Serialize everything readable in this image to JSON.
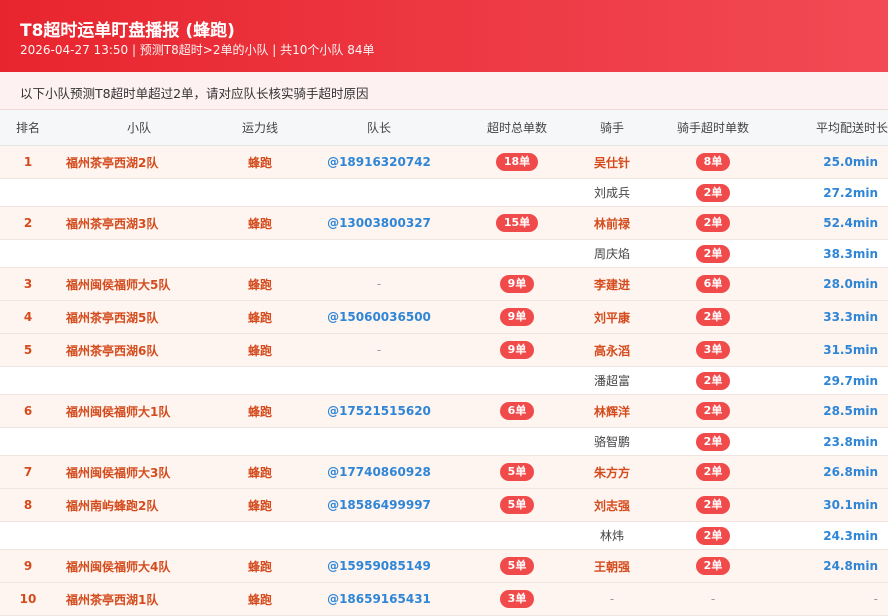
{
  "header": {
    "title": "T8超时运单盯盘播报 (蜂跑)",
    "subtitle": "2026-04-27 13:50 | 预测T8超时>2单的小队 | 共10个小队 84单",
    "bg_color": "#e8252e"
  },
  "notice": "以下小队预测T8超时单超过2单，请对应队长核实骑手超时原因",
  "columns": [
    "排名",
    "小队",
    "运力线",
    "队长",
    "超时总单数",
    "骑手",
    "骑手超时单数",
    "平均配送时长"
  ],
  "rows": [
    {
      "kind": "team",
      "rank": "1",
      "team": "福州茶亭西湖2队",
      "line": "蜂跑",
      "captain": "@18916320742",
      "total": "18单",
      "rider": "吴仕针",
      "rider_count": "8单",
      "avg": "25.0min"
    },
    {
      "kind": "sub",
      "rank": "",
      "team": "",
      "line": "",
      "captain": "",
      "total": "",
      "rider": "刘成兵",
      "rider_count": "2单",
      "avg": "27.2min"
    },
    {
      "kind": "team",
      "rank": "2",
      "team": "福州茶亭西湖3队",
      "line": "蜂跑",
      "captain": "@13003800327",
      "total": "15单",
      "rider": "林前禄",
      "rider_count": "2单",
      "avg": "52.4min"
    },
    {
      "kind": "sub",
      "rank": "",
      "team": "",
      "line": "",
      "captain": "",
      "total": "",
      "rider": "周庆焰",
      "rider_count": "2单",
      "avg": "38.3min"
    },
    {
      "kind": "team",
      "rank": "3",
      "team": "福州闽侯福师大5队",
      "line": "蜂跑",
      "captain": "-",
      "total": "9单",
      "rider": "李建进",
      "rider_count": "6单",
      "avg": "28.0min"
    },
    {
      "kind": "team",
      "rank": "4",
      "team": "福州茶亭西湖5队",
      "line": "蜂跑",
      "captain": "@15060036500",
      "total": "9单",
      "rider": "刘平康",
      "rider_count": "2单",
      "avg": "33.3min"
    },
    {
      "kind": "team",
      "rank": "5",
      "team": "福州茶亭西湖6队",
      "line": "蜂跑",
      "captain": "-",
      "total": "9单",
      "rider": "高永滔",
      "rider_count": "3单",
      "avg": "31.5min"
    },
    {
      "kind": "sub",
      "rank": "",
      "team": "",
      "line": "",
      "captain": "",
      "total": "",
      "rider": "潘超富",
      "rider_count": "2单",
      "avg": "29.7min"
    },
    {
      "kind": "team",
      "rank": "6",
      "team": "福州闽侯福师大1队",
      "line": "蜂跑",
      "captain": "@17521515620",
      "total": "6单",
      "rider": "林辉洋",
      "rider_count": "2单",
      "avg": "28.5min"
    },
    {
      "kind": "sub",
      "rank": "",
      "team": "",
      "line": "",
      "captain": "",
      "total": "",
      "rider": "骆智鹏",
      "rider_count": "2单",
      "avg": "23.8min"
    },
    {
      "kind": "team",
      "rank": "7",
      "team": "福州闽侯福师大3队",
      "line": "蜂跑",
      "captain": "@17740860928",
      "total": "5单",
      "rider": "朱方方",
      "rider_count": "2单",
      "avg": "26.8min"
    },
    {
      "kind": "team",
      "rank": "8",
      "team": "福州南屿蜂跑2队",
      "line": "蜂跑",
      "captain": "@18586499997",
      "total": "5单",
      "rider": "刘志强",
      "rider_count": "2单",
      "avg": "30.1min"
    },
    {
      "kind": "sub",
      "rank": "",
      "team": "",
      "line": "",
      "captain": "",
      "total": "",
      "rider": "林炜",
      "rider_count": "2单",
      "avg": "24.3min"
    },
    {
      "kind": "team",
      "rank": "9",
      "team": "福州闽侯福师大4队",
      "line": "蜂跑",
      "captain": "@15959085149",
      "total": "5单",
      "rider": "王朝强",
      "rider_count": "2单",
      "avg": "24.8min"
    },
    {
      "kind": "team",
      "rank": "10",
      "team": "福州茶亭西湖1队",
      "line": "蜂跑",
      "captain": "@18659165431",
      "total": "3单",
      "rider": "-",
      "rider_count": "-",
      "avg": "-"
    }
  ]
}
